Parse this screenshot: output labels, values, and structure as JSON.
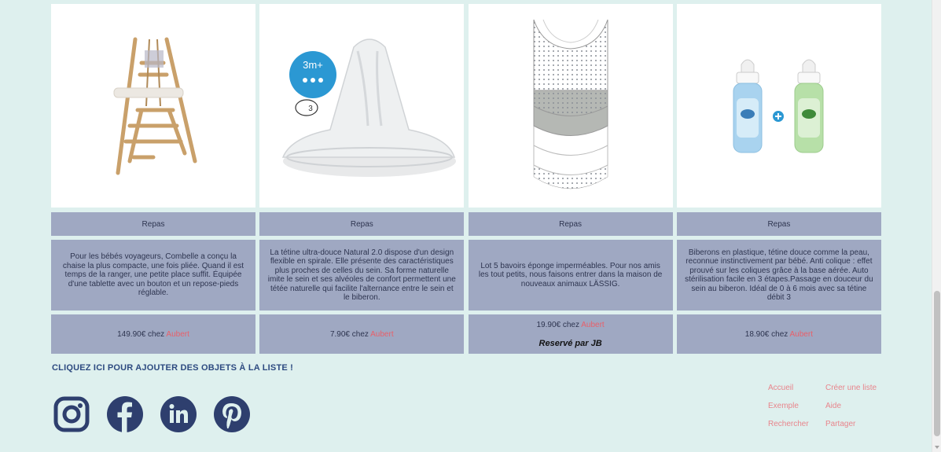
{
  "products": [
    {
      "image": "high-chair-image",
      "category": "Repas",
      "description": "Pour les bébés voyageurs, Combelle a conçu la chaise la plus compacte, une fois pliée. Quand il est temps de la ranger, une petite place suffit. Équipée d'une tablette avec un bouton et un repose-pieds réglable.",
      "price": "149.90€ chez",
      "store": "Aubert",
      "reserved": ""
    },
    {
      "image": "teat-image",
      "image_badge_text": "3m+",
      "image_badge_number": "3",
      "category": "Repas",
      "description": "La tétine ultra-douce Natural 2.0 dispose d'un design flexible en spirale. Elle présente des caractéristiques plus proches de celles du sein. Sa forme naturelle imite le sein et ses alvéoles de confort permettent une tétée naturelle qui facilite l'alternance entre le sein et le biberon.",
      "price": "7.90€ chez",
      "store": "Aubert",
      "reserved": ""
    },
    {
      "image": "bibs-image",
      "category": "Repas",
      "description": "Lot 5 bavoirs éponge imperméables. Pour nos amis les tout petits, nous faisons entrer dans la maison de nouveaux animaux LÄSSIG.",
      "price": "19.90€ chez",
      "store": "Aubert",
      "reserved": "Reservé par JB"
    },
    {
      "image": "baby-bottles-image",
      "category": "Repas",
      "description": "Biberons en plastique, tétine douce comme la peau, reconnue instinctivement par bébé. Anti colique : effet prouvé sur les coliques grâce à la base aérée. Auto stérilisation facile en 3 étapes.Passage en douceur du sein au biberon. Idéal de 0 à 6 mois avec sa tétine débit 3",
      "price": "18.90€ chez",
      "store": "Aubert",
      "reserved": ""
    }
  ],
  "add_link": "CLIQUEZ ICI POUR AJOUTER DES OBJETS À LA LISTE !",
  "socials": [
    "instagram-icon",
    "facebook-icon",
    "linkedin-icon",
    "pinterest-icon"
  ],
  "footer_links": {
    "accueil": "Accueil",
    "creer": "Créer une liste",
    "exemple": "Exemple",
    "aide": "Aide",
    "rechercher": "Rechercher",
    "partager": "Partager"
  },
  "colors": {
    "background": "#def0ee",
    "card": "#9fa8c2",
    "accent": "#e8606a",
    "social": "#2e3f6e"
  }
}
